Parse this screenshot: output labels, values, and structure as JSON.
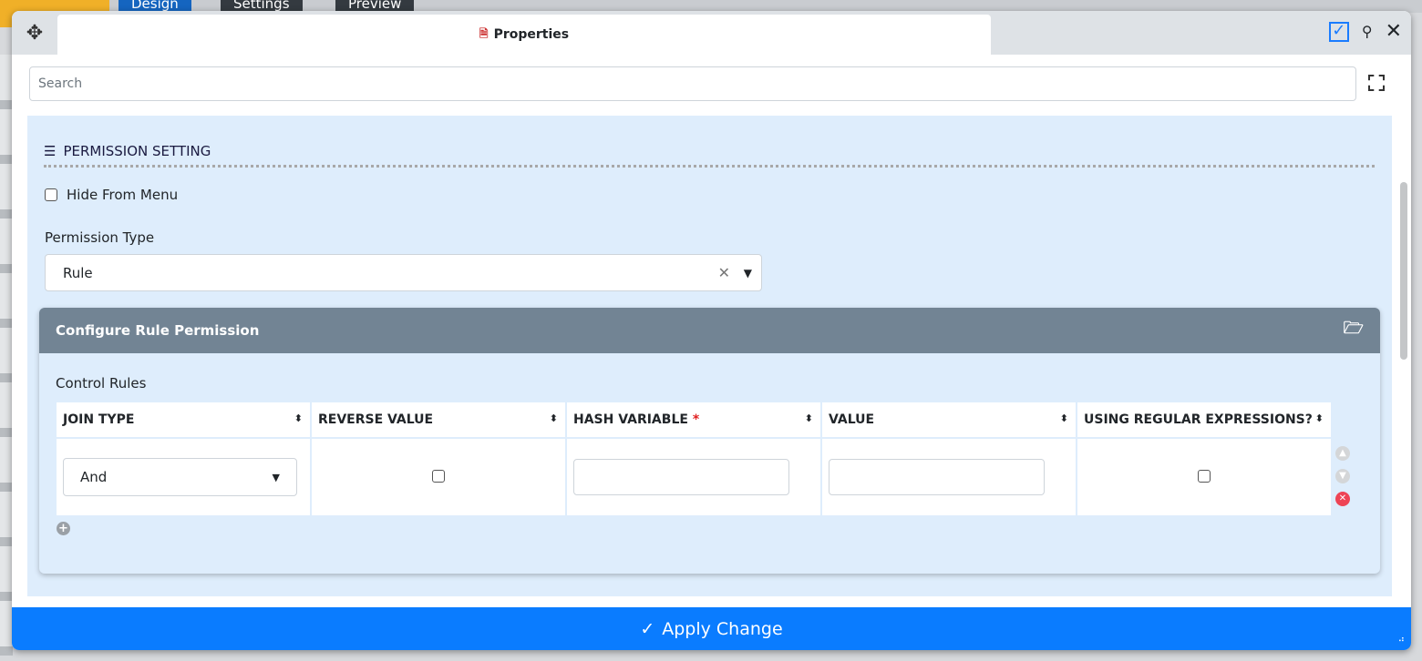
{
  "background": {
    "tabs": [
      "Design",
      "Settings",
      "Preview"
    ]
  },
  "dialog": {
    "title": "Properties",
    "search_placeholder": "Search",
    "section_title": "PERMISSION SETTING",
    "hide_from_menu": {
      "label": "Hide From Menu",
      "checked": false
    },
    "permission_type": {
      "label": "Permission Type",
      "value": "Rule"
    },
    "card": {
      "title": "Configure Rule Permission",
      "control_rules_label": "Control Rules",
      "columns": [
        {
          "label": "JOIN TYPE",
          "required": false
        },
        {
          "label": "REVERSE VALUE",
          "required": false
        },
        {
          "label": "HASH VARIABLE",
          "required": true
        },
        {
          "label": "VALUE",
          "required": false
        },
        {
          "label": "USING REGULAR EXPRESSIONS?",
          "required": false
        }
      ],
      "rows": [
        {
          "join_type": "And",
          "reverse_value": false,
          "hash_variable": "",
          "value": "",
          "regex": false
        }
      ]
    },
    "apply_label": "Apply Change"
  },
  "colors": {
    "accent": "#0a7cff",
    "card_header": "#728494",
    "content_bg": "#deedfc"
  }
}
